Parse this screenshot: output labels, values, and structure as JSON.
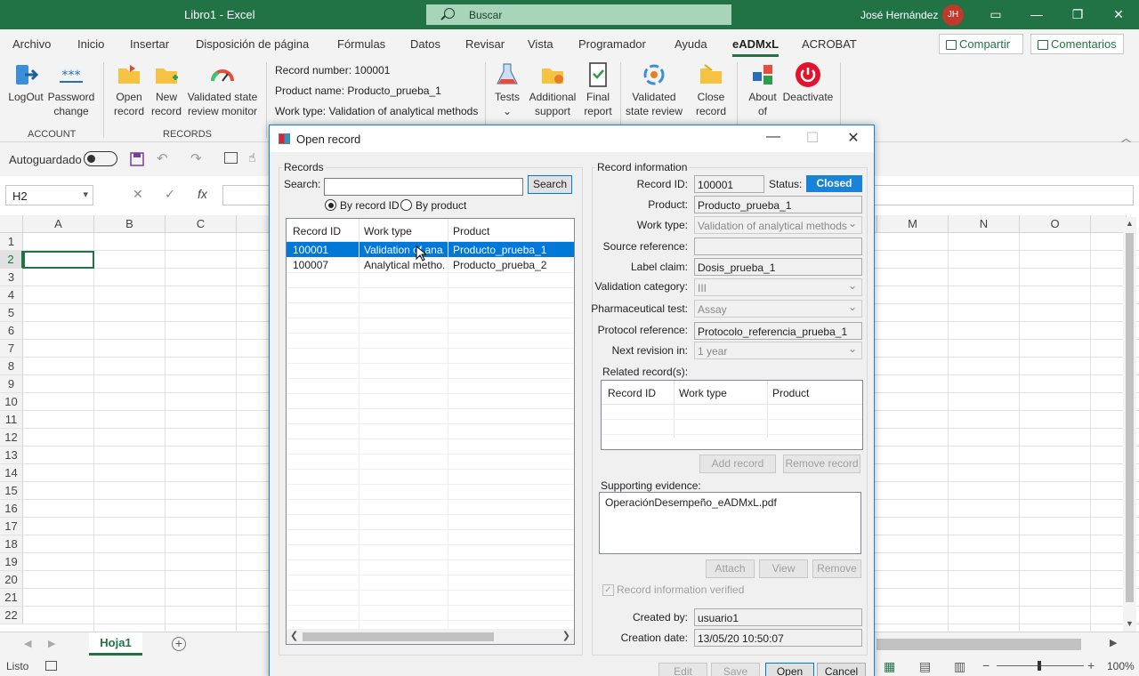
{
  "window": {
    "title": "Libro1  -  Excel",
    "search_placeholder": "Buscar",
    "user_name": "José Hernández",
    "user_initials": "JH"
  },
  "ribbon_tabs": [
    "Archivo",
    "Inicio",
    "Insertar",
    "Disposición de página",
    "Fórmulas",
    "Datos",
    "Revisar",
    "Vista",
    "Programador",
    "Ayuda",
    "eADMxL",
    "ACROBAT"
  ],
  "ribbon_actions": {
    "share": "Compartir",
    "comments": "Comentarios"
  },
  "ribbon": {
    "account_buttons": [
      {
        "line1": "LogOut",
        "line2": ""
      },
      {
        "line1": "Password",
        "line2": "change"
      }
    ],
    "records_buttons": [
      {
        "line1": "Open",
        "line2": "record"
      },
      {
        "line1": "New",
        "line2": "record"
      },
      {
        "line1": "Validated state",
        "line2": "review monitor"
      }
    ],
    "group_account": "ACCOUNT",
    "group_records": "RECORDS",
    "record_number": "Record number: 100001",
    "product_name": "Product name: Producto_prueba_1",
    "work_type": "Work type: Validation of analytical methods",
    "tool_buttons": [
      {
        "line1": "Tests",
        "line2": "⌄"
      },
      {
        "line1": "Additional",
        "line2": "support"
      },
      {
        "line1": "Final",
        "line2": "report"
      },
      {
        "line1": "Validated",
        "line2": "state review"
      },
      {
        "line1": "Close",
        "line2": "record"
      },
      {
        "line1": "About",
        "line2": "of"
      },
      {
        "line1": "Deactivate",
        "line2": ""
      }
    ]
  },
  "qat": {
    "autosave_label": "Autoguardado"
  },
  "formula_bar": {
    "name_box": "H2",
    "cancel": "✕",
    "enter": "✓",
    "fx": "fx"
  },
  "grid": {
    "columns_left": [
      "A",
      "B",
      "C"
    ],
    "columns_right": [
      "M",
      "N",
      "O"
    ],
    "rows": [
      "1",
      "2",
      "3",
      "4",
      "5",
      "6",
      "7",
      "8",
      "9",
      "10",
      "11",
      "12",
      "13",
      "14",
      "15",
      "16",
      "17",
      "18",
      "19",
      "20",
      "21",
      "22"
    ]
  },
  "sheets": {
    "active": "Hoja1",
    "add": "+"
  },
  "statusbar": {
    "ready": "Listo",
    "zoom": "100%"
  },
  "dialog": {
    "title": "Open record",
    "records_legend": "Records",
    "search_label": "Search:",
    "search_value": "",
    "search_button": "Search",
    "radio_by_id": "By record ID",
    "radio_by_product": "By product",
    "list_headers": [
      "Record ID",
      "Work type",
      "Product"
    ],
    "list_rows": [
      {
        "id": "100001",
        "work_type": "Validation of ana...",
        "product": "Producto_prueba_1"
      },
      {
        "id": "100007",
        "work_type": "Analytical metho...",
        "product": "Producto_prueba_2"
      }
    ],
    "info_legend": "Record information",
    "fields": {
      "record_id_label": "Record ID:",
      "record_id": "100001",
      "status_label": "Status:",
      "status": "Closed",
      "product_label": "Product:",
      "product": "Producto_prueba_1",
      "work_type_label": "Work type:",
      "work_type": "Validation of analytical methods",
      "source_label": "Source reference:",
      "source": "",
      "label_claim_label": "Label claim:",
      "label_claim": "Dosis_prueba_1",
      "val_cat_label": "Validation category:",
      "val_cat": "III",
      "pharma_label": "Pharmaceutical test:",
      "pharma": "Assay",
      "protocol_label": "Protocol reference:",
      "protocol": "Protocolo_referencia_prueba_1",
      "next_rev_label": "Next revision in:",
      "next_rev": "1 year"
    },
    "related_label": "Related record(s):",
    "related_headers": [
      "Record ID",
      "Work type",
      "Product"
    ],
    "add_record": "Add record",
    "remove_record": "Remove record",
    "evidence_label": "Supporting evidence:",
    "evidence_items": [
      "OperaciónDesempeño_eADMxL.pdf"
    ],
    "attach": "Attach",
    "view": "View",
    "remove": "Remove",
    "verified_label": "Record information verified",
    "created_by_label": "Created by:",
    "created_by": "usuario1",
    "creation_date_label": "Creation date:",
    "creation_date": "13/05/20 10:50:07",
    "buttons": {
      "edit": "Edit",
      "save": "Save",
      "open": "Open",
      "cancel": "Cancel"
    }
  },
  "colors": {
    "excel_green": "#217346",
    "accent_blue": "#1883d7",
    "selection_blue": "#0078d7"
  }
}
